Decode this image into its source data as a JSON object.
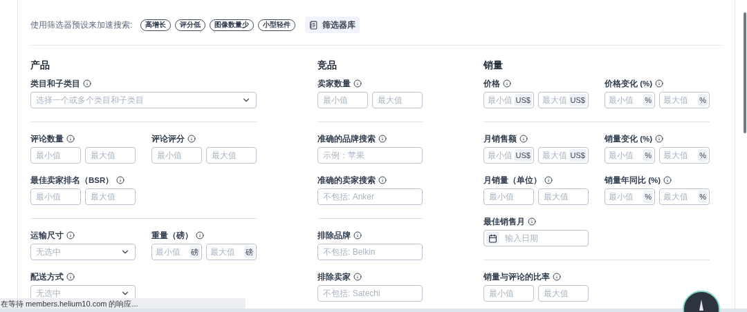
{
  "presets": {
    "label": "使用筛选器预设来加速搜索:",
    "chips": [
      "高增长",
      "评分低",
      "图像数量少",
      "小型轻件"
    ],
    "library": "筛选器库"
  },
  "sections": [
    {
      "title": "产品",
      "groups": [
        [
          [
            {
              "label": "类目和子类目",
              "kind": "wide-select",
              "placeholder": "选择一个或多个类目和子类目"
            }
          ]
        ],
        [
          [
            {
              "label": "评论数量",
              "kind": "range",
              "placeholders": [
                "最小值",
                "最大值"
              ]
            },
            {
              "label": "评论评分",
              "kind": "range",
              "placeholders": [
                "最小值",
                "最大值"
              ]
            }
          ],
          [
            {
              "label": "最佳卖家排名（BSR）",
              "kind": "range",
              "placeholders": [
                "最小值",
                "最大值"
              ]
            }
          ]
        ],
        [
          [
            {
              "label": "运输尺寸",
              "kind": "select",
              "placeholder": "无选中"
            },
            {
              "label": "重量（磅）",
              "kind": "range",
              "placeholders": [
                "最小值",
                "最大值"
              ],
              "units": [
                "磅",
                "磅"
              ]
            }
          ],
          [
            {
              "label": "配送方式",
              "kind": "select",
              "placeholder": "无选中"
            }
          ]
        ]
      ]
    },
    {
      "title": "竞品",
      "groups": [
        [
          [
            {
              "label": "卖家数量",
              "kind": "range",
              "placeholders": [
                "最小值",
                "最大值"
              ]
            }
          ]
        ],
        [
          [
            {
              "label": "准确的品牌搜索",
              "kind": "text",
              "placeholder": "示例：苹果"
            }
          ],
          [
            {
              "label": "准确的卖家搜索",
              "kind": "text",
              "placeholder": "不包括: Anker"
            }
          ]
        ],
        [
          [
            {
              "label": "排除品牌",
              "kind": "text",
              "placeholder": "不包括: Belkin"
            }
          ],
          [
            {
              "label": "排除卖家",
              "kind": "text",
              "placeholder": "不包括: Satechi"
            }
          ]
        ]
      ]
    },
    {
      "title": "销量",
      "groups": [
        [
          [
            {
              "label": "价格",
              "kind": "range",
              "placeholders": [
                "最小值",
                "最大值"
              ],
              "units": [
                "US$",
                "US$"
              ]
            },
            {
              "label": "价格变化 (%)",
              "kind": "range",
              "placeholders": [
                "最小值",
                "最大值"
              ],
              "units": [
                "%",
                "%"
              ]
            }
          ]
        ],
        [
          [
            {
              "label": "月销售额",
              "kind": "range",
              "placeholders": [
                "最小值",
                "最大值"
              ],
              "units": [
                "US$",
                "US$"
              ]
            },
            {
              "label": "销量变化 (%)",
              "kind": "range",
              "placeholders": [
                "最小值",
                "最大值"
              ],
              "units": [
                "%",
                "%"
              ]
            }
          ],
          [
            {
              "label": "月销量（单位）",
              "kind": "range",
              "placeholders": [
                "最小值",
                "最大值"
              ]
            },
            {
              "label": "销量年同比 (%)",
              "kind": "range",
              "placeholders": [
                "最小值",
                "最大值"
              ],
              "units": [
                "%",
                "%"
              ]
            }
          ],
          [
            {
              "label": "最佳销售月",
              "kind": "date",
              "placeholder": "输入日期"
            }
          ]
        ],
        [
          [
            {
              "label": "销量与评论的比率",
              "kind": "range",
              "placeholders": [
                "最小值",
                "最大值"
              ]
            }
          ]
        ]
      ]
    }
  ],
  "status": "在等待 members.helium10.com 的响应..."
}
